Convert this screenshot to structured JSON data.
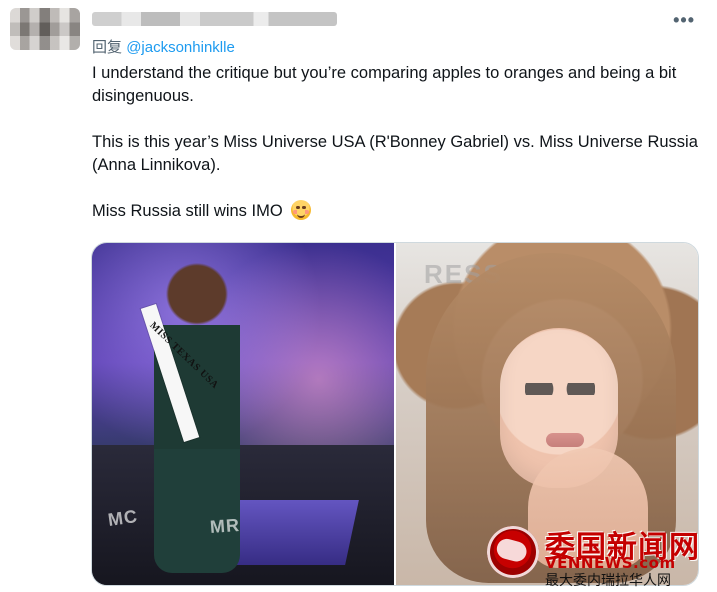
{
  "header": {
    "reply_prefix": "回复",
    "mention": "@jacksonhinklle",
    "more_label": "•••"
  },
  "tweet": {
    "paragraphs": [
      "I understand the critique but you’re comparing apples to oranges and being a bit disingenuous.",
      "This is this year’s Miss Universe USA (R'Bonney Gabriel) vs. Miss Universe Russia (Anna Linnikova).",
      "Miss Russia still wins IMO"
    ],
    "emoji": "relieved-face-emoji"
  },
  "media": {
    "left_sash_text": "MISS TEXAS USA",
    "left_stage_text_1": "MC",
    "left_stage_text_2": "MR",
    "right_backdrop_text": "RESS"
  },
  "watermark": {
    "top": "委国新闻网",
    "mid": "VENNEWS.com",
    "bottom": "最大委内瑞拉华人网"
  }
}
